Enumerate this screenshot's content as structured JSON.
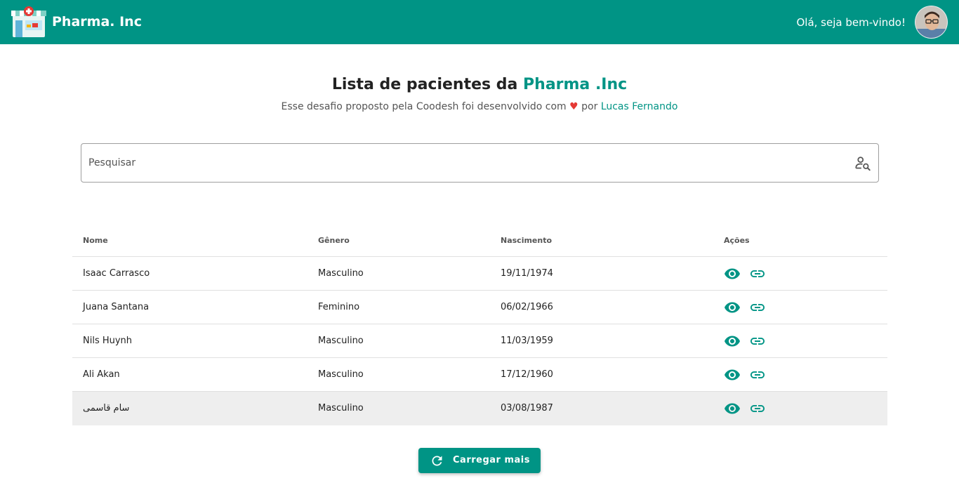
{
  "header": {
    "brand": "Pharma. Inc",
    "greeting": "Olá, seja bem-vindo!",
    "logo_icon": "pharmacy-store-icon",
    "avatar_icon": "user-avatar"
  },
  "intro": {
    "title_prefix": "Lista de pacientes da ",
    "title_accent": "Pharma .Inc",
    "subtitle_before": "Esse desafio proposto pela Coodesh foi desenvolvido com ",
    "subtitle_heart": "♥",
    "subtitle_middle": " por ",
    "subtitle_author": "Lucas Fernando"
  },
  "search": {
    "placeholder": "Pesquisar",
    "value": "",
    "icon": "person-search-icon"
  },
  "table": {
    "headers": {
      "name": "Nome",
      "gender": "Gênero",
      "birth": "Nascimento",
      "actions": "Ações"
    },
    "rows": [
      {
        "name": "Isaac Carrasco",
        "gender": "Masculino",
        "birth": "19/11/1974"
      },
      {
        "name": "Juana Santana",
        "gender": "Feminino",
        "birth": "06/02/1966"
      },
      {
        "name": "Nils Huynh",
        "gender": "Masculino",
        "birth": "11/03/1959"
      },
      {
        "name": "Ali Akan",
        "gender": "Masculino",
        "birth": "17/12/1960"
      },
      {
        "name": "سام قاسمی",
        "gender": "Masculino",
        "birth": "03/08/1987"
      }
    ],
    "action_icons": [
      "eye-icon",
      "link-icon"
    ]
  },
  "load_more": {
    "label": "Carregar mais",
    "icon": "refresh-icon"
  },
  "colors": {
    "primary": "#009485",
    "heart": "#e53935",
    "highlight_row": "#eeeeee"
  }
}
